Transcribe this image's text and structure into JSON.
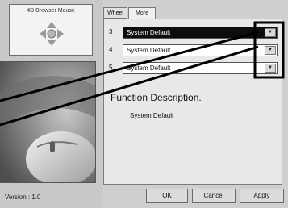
{
  "logo": {
    "title": "4D Browser Mouse"
  },
  "tabs": [
    {
      "label": "Wheel"
    },
    {
      "label": "More"
    }
  ],
  "rows": [
    {
      "num": "3",
      "value": "System Default"
    },
    {
      "num": "4",
      "value": "System Default"
    },
    {
      "num": "5",
      "value": "System Default"
    }
  ],
  "function": {
    "title": "Function Description.",
    "description": "System Default"
  },
  "version": "Version : 1.0",
  "buttons": {
    "ok": "OK",
    "cancel": "Cancel",
    "apply": "Apply"
  }
}
